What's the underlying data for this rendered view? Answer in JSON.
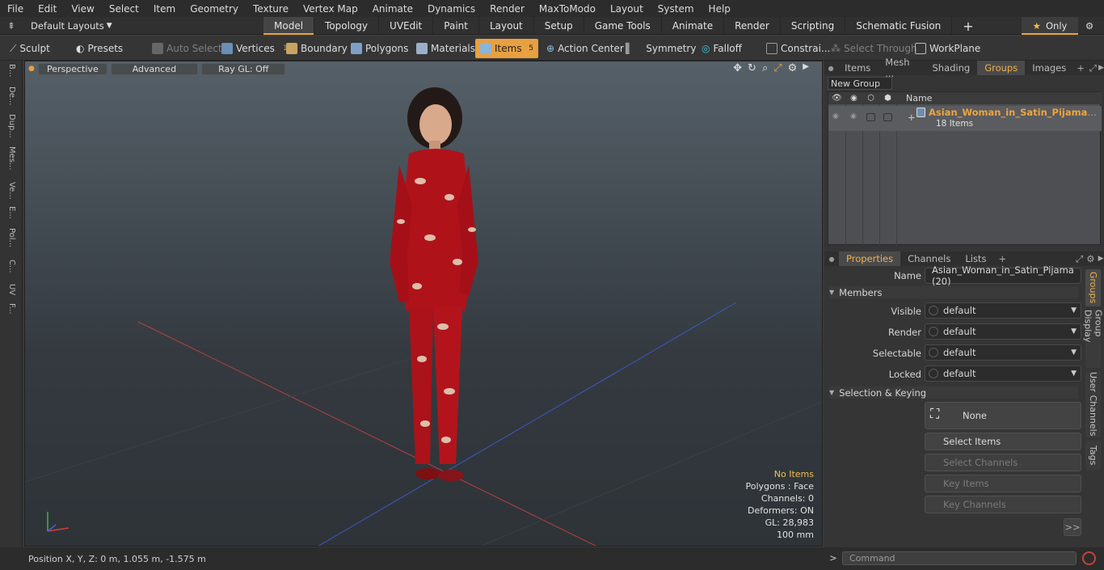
{
  "menu": [
    "File",
    "Edit",
    "View",
    "Select",
    "Item",
    "Geometry",
    "Texture",
    "Vertex Map",
    "Animate",
    "Dynamics",
    "Render",
    "MaxToModo",
    "Layout",
    "System",
    "Help"
  ],
  "layouts_label": "Default Layouts",
  "mode_tabs": [
    "Model",
    "Topology",
    "UVEdit",
    "Paint",
    "Layout",
    "Setup",
    "Game Tools",
    "Animate",
    "Render",
    "Scripting",
    "Schematic Fusion"
  ],
  "only_label": "Only",
  "toolbar": {
    "sculpt": "Sculpt",
    "presets": "Presets",
    "auto_select": "Auto Select",
    "vertices": "Vertices",
    "vertices_count": "1",
    "boundary": "Boundary",
    "polygons": "Polygons",
    "materials": "Materials",
    "items": "Items",
    "items_count": "5",
    "action_center": "Action Center",
    "symmetry": "Symmetry",
    "falloff": "Falloff",
    "constraints": "Constrai...",
    "select_through": "Select Through",
    "workplane": "WorkPlane"
  },
  "left_tabs": [
    "B...",
    "De...",
    "Dup...",
    "Mes...",
    "Ve...",
    "E...",
    "Pol...",
    "C...",
    "UV",
    "F..."
  ],
  "viewport": {
    "view_mode": "Perspective",
    "advanced": "Advanced",
    "raygl": "Ray GL: Off",
    "stats": {
      "items": "No Items",
      "polygons": "Polygons : Face",
      "channels": "Channels: 0",
      "deformers": "Deformers: ON",
      "gl": "GL: 28,983",
      "scale": "100 mm"
    }
  },
  "status": {
    "position": "Position X, Y, Z:   0 m, 1.055 m, -1.575 m"
  },
  "top_panel": {
    "tabs": [
      "Items",
      "Mesh ...",
      "Shading",
      "Groups",
      "Images"
    ],
    "active_tab": "Groups",
    "new_group": "New Group",
    "col_name": "Name",
    "group_name": "Asian_Woman_in_Satin_Pijama",
    "group_count": "18 Items"
  },
  "props_panel": {
    "tabs": [
      "Properties",
      "Channels",
      "Lists"
    ],
    "name_label": "Name",
    "name_value": "Asian_Woman_in_Satin_Pijama (20)",
    "members": "Members",
    "visible_label": "Visible",
    "render_label": "Render",
    "selectable_label": "Selectable",
    "locked_label": "Locked",
    "default_value": "default",
    "sel_keying": "Selection & Keying",
    "none_label": "None",
    "select_items": "Select Items",
    "select_channels": "Select Channels",
    "key_items": "Key Items",
    "key_channels": "Key Channels",
    "more": ">>",
    "side_tabs": [
      "Groups",
      "Group Display",
      "User Channels",
      "Tags"
    ]
  },
  "command_placeholder": "Command",
  "colors": {
    "accent": "#e8a040",
    "bg": "#353535",
    "viewport_top": "#566068"
  }
}
